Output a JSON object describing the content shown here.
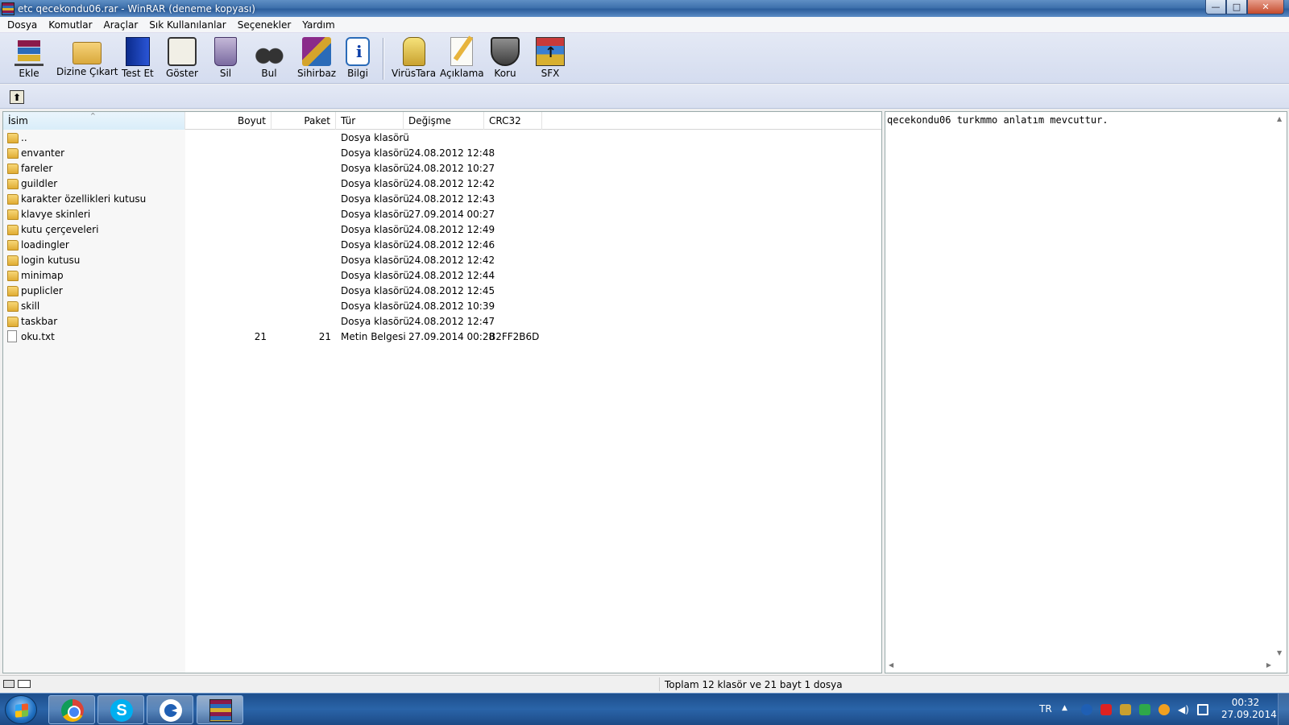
{
  "window": {
    "title": "etc qecekondu06.rar - WinRAR (deneme kopyası)",
    "min": "—",
    "max": "□",
    "close": "✕"
  },
  "menu": [
    "Dosya",
    "Komutlar",
    "Araçlar",
    "Sık Kullanılanlar",
    "Seçenekler",
    "Yardım"
  ],
  "toolbar": [
    {
      "label": "Ekle",
      "icon": "add-archive-icon"
    },
    {
      "label": "Dizine Çıkart",
      "icon": "extract-to-icon"
    },
    {
      "label": "Test Et",
      "icon": "test-icon"
    },
    {
      "label": "Göster",
      "icon": "view-icon"
    },
    {
      "label": "Sil",
      "icon": "delete-icon"
    },
    {
      "label": "Bul",
      "icon": "find-icon"
    },
    {
      "label": "Sihirbaz",
      "icon": "wizard-icon"
    },
    {
      "label": "Bilgi",
      "icon": "info-icon"
    },
    {
      "label": "VirüsTara",
      "icon": "virus-scan-icon"
    },
    {
      "label": "Açıklama",
      "icon": "comment-icon"
    },
    {
      "label": "Koru",
      "icon": "protect-icon"
    },
    {
      "label": "SFX",
      "icon": "sfx-icon"
    }
  ],
  "columns": {
    "name": "İsim",
    "size": "Boyut",
    "packed": "Paket",
    "type": "Tür",
    "modified": "Değişme",
    "crc": "CRC32"
  },
  "files": [
    {
      "name": "..",
      "size": "",
      "packed": "",
      "type": "Dosya klasörü",
      "modified": "",
      "crc": "",
      "kind": "folder"
    },
    {
      "name": "envanter",
      "size": "",
      "packed": "",
      "type": "Dosya klasörü",
      "modified": "24.08.2012 12:48",
      "crc": "",
      "kind": "folder"
    },
    {
      "name": "fareler",
      "size": "",
      "packed": "",
      "type": "Dosya klasörü",
      "modified": "24.08.2012 10:27",
      "crc": "",
      "kind": "folder"
    },
    {
      "name": "guildler",
      "size": "",
      "packed": "",
      "type": "Dosya klasörü",
      "modified": "24.08.2012 12:42",
      "crc": "",
      "kind": "folder"
    },
    {
      "name": "karakter özellikleri kutusu",
      "size": "",
      "packed": "",
      "type": "Dosya klasörü",
      "modified": "24.08.2012 12:43",
      "crc": "",
      "kind": "folder"
    },
    {
      "name": "klavye skinleri",
      "size": "",
      "packed": "",
      "type": "Dosya klasörü",
      "modified": "27.09.2014 00:27",
      "crc": "",
      "kind": "folder"
    },
    {
      "name": "kutu çerçeveleri",
      "size": "",
      "packed": "",
      "type": "Dosya klasörü",
      "modified": "24.08.2012 12:49",
      "crc": "",
      "kind": "folder"
    },
    {
      "name": "loadingler",
      "size": "",
      "packed": "",
      "type": "Dosya klasörü",
      "modified": "24.08.2012 12:46",
      "crc": "",
      "kind": "folder"
    },
    {
      "name": "login kutusu",
      "size": "",
      "packed": "",
      "type": "Dosya klasörü",
      "modified": "24.08.2012 12:42",
      "crc": "",
      "kind": "folder"
    },
    {
      "name": "minimap",
      "size": "",
      "packed": "",
      "type": "Dosya klasörü",
      "modified": "24.08.2012 12:44",
      "crc": "",
      "kind": "folder"
    },
    {
      "name": "puplicler",
      "size": "",
      "packed": "",
      "type": "Dosya klasörü",
      "modified": "24.08.2012 12:45",
      "crc": "",
      "kind": "folder"
    },
    {
      "name": "skill",
      "size": "",
      "packed": "",
      "type": "Dosya klasörü",
      "modified": "24.08.2012 10:39",
      "crc": "",
      "kind": "folder"
    },
    {
      "name": "taskbar",
      "size": "",
      "packed": "",
      "type": "Dosya klasörü",
      "modified": "24.08.2012 12:47",
      "crc": "",
      "kind": "folder"
    },
    {
      "name": "oku.txt",
      "size": "21",
      "packed": "21",
      "type": "Metin Belgesi",
      "modified": "27.09.2014 00:28",
      "crc": "B2FF2B6D",
      "kind": "file"
    }
  ],
  "comment": "qecekondu06 turkmmo anlatım mevcuttur.",
  "status": {
    "summary": "Toplam 12 klasör ve 21 bayt 1 dosya"
  },
  "taskbar": {
    "apps": [
      "chrome-icon",
      "skype-icon",
      "c-app-icon",
      "winrar-icon"
    ],
    "language": "TR",
    "time": "00:32",
    "date": "27.09.2014"
  }
}
